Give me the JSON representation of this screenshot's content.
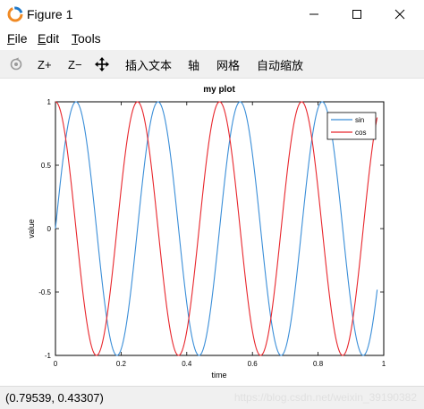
{
  "window": {
    "title": "Figure 1"
  },
  "menu": [
    {
      "key": "F",
      "rest": "ile"
    },
    {
      "key": "E",
      "rest": "dit"
    },
    {
      "key": "T",
      "rest": "ools"
    }
  ],
  "toolbar": {
    "zoom_in": "Z+",
    "zoom_out": "Z−",
    "insert_text": "插入文本",
    "axis": "轴",
    "grid": "网格",
    "autoscale": "自动缩放"
  },
  "status": {
    "coords": "(0.79539, 0.43307)",
    "watermark": "https://blog.csdn.net/weixin_39190382"
  },
  "colors": {
    "sin": "#3a8ed8",
    "cos": "#e8262c"
  },
  "chart_data": {
    "type": "line",
    "title": "my plot",
    "xlabel": "time",
    "ylabel": "value",
    "xlim": [
      0,
      1
    ],
    "ylim": [
      -1,
      1
    ],
    "xticks": [
      "0",
      "0.2",
      "0.4",
      "0.6",
      "0.8",
      "1"
    ],
    "yticks": [
      "-1",
      "-0.5",
      "0",
      "0.5",
      "1"
    ],
    "legend_position": "top-right",
    "x_range": [
      0,
      0.98
    ],
    "series": [
      {
        "name": "sin",
        "function": "sin(2*pi*4*x)",
        "frequency_hz": 4,
        "color": "#3a8ed8"
      },
      {
        "name": "cos",
        "function": "cos(2*pi*4*x)",
        "frequency_hz": 4,
        "color": "#e8262c"
      }
    ]
  }
}
